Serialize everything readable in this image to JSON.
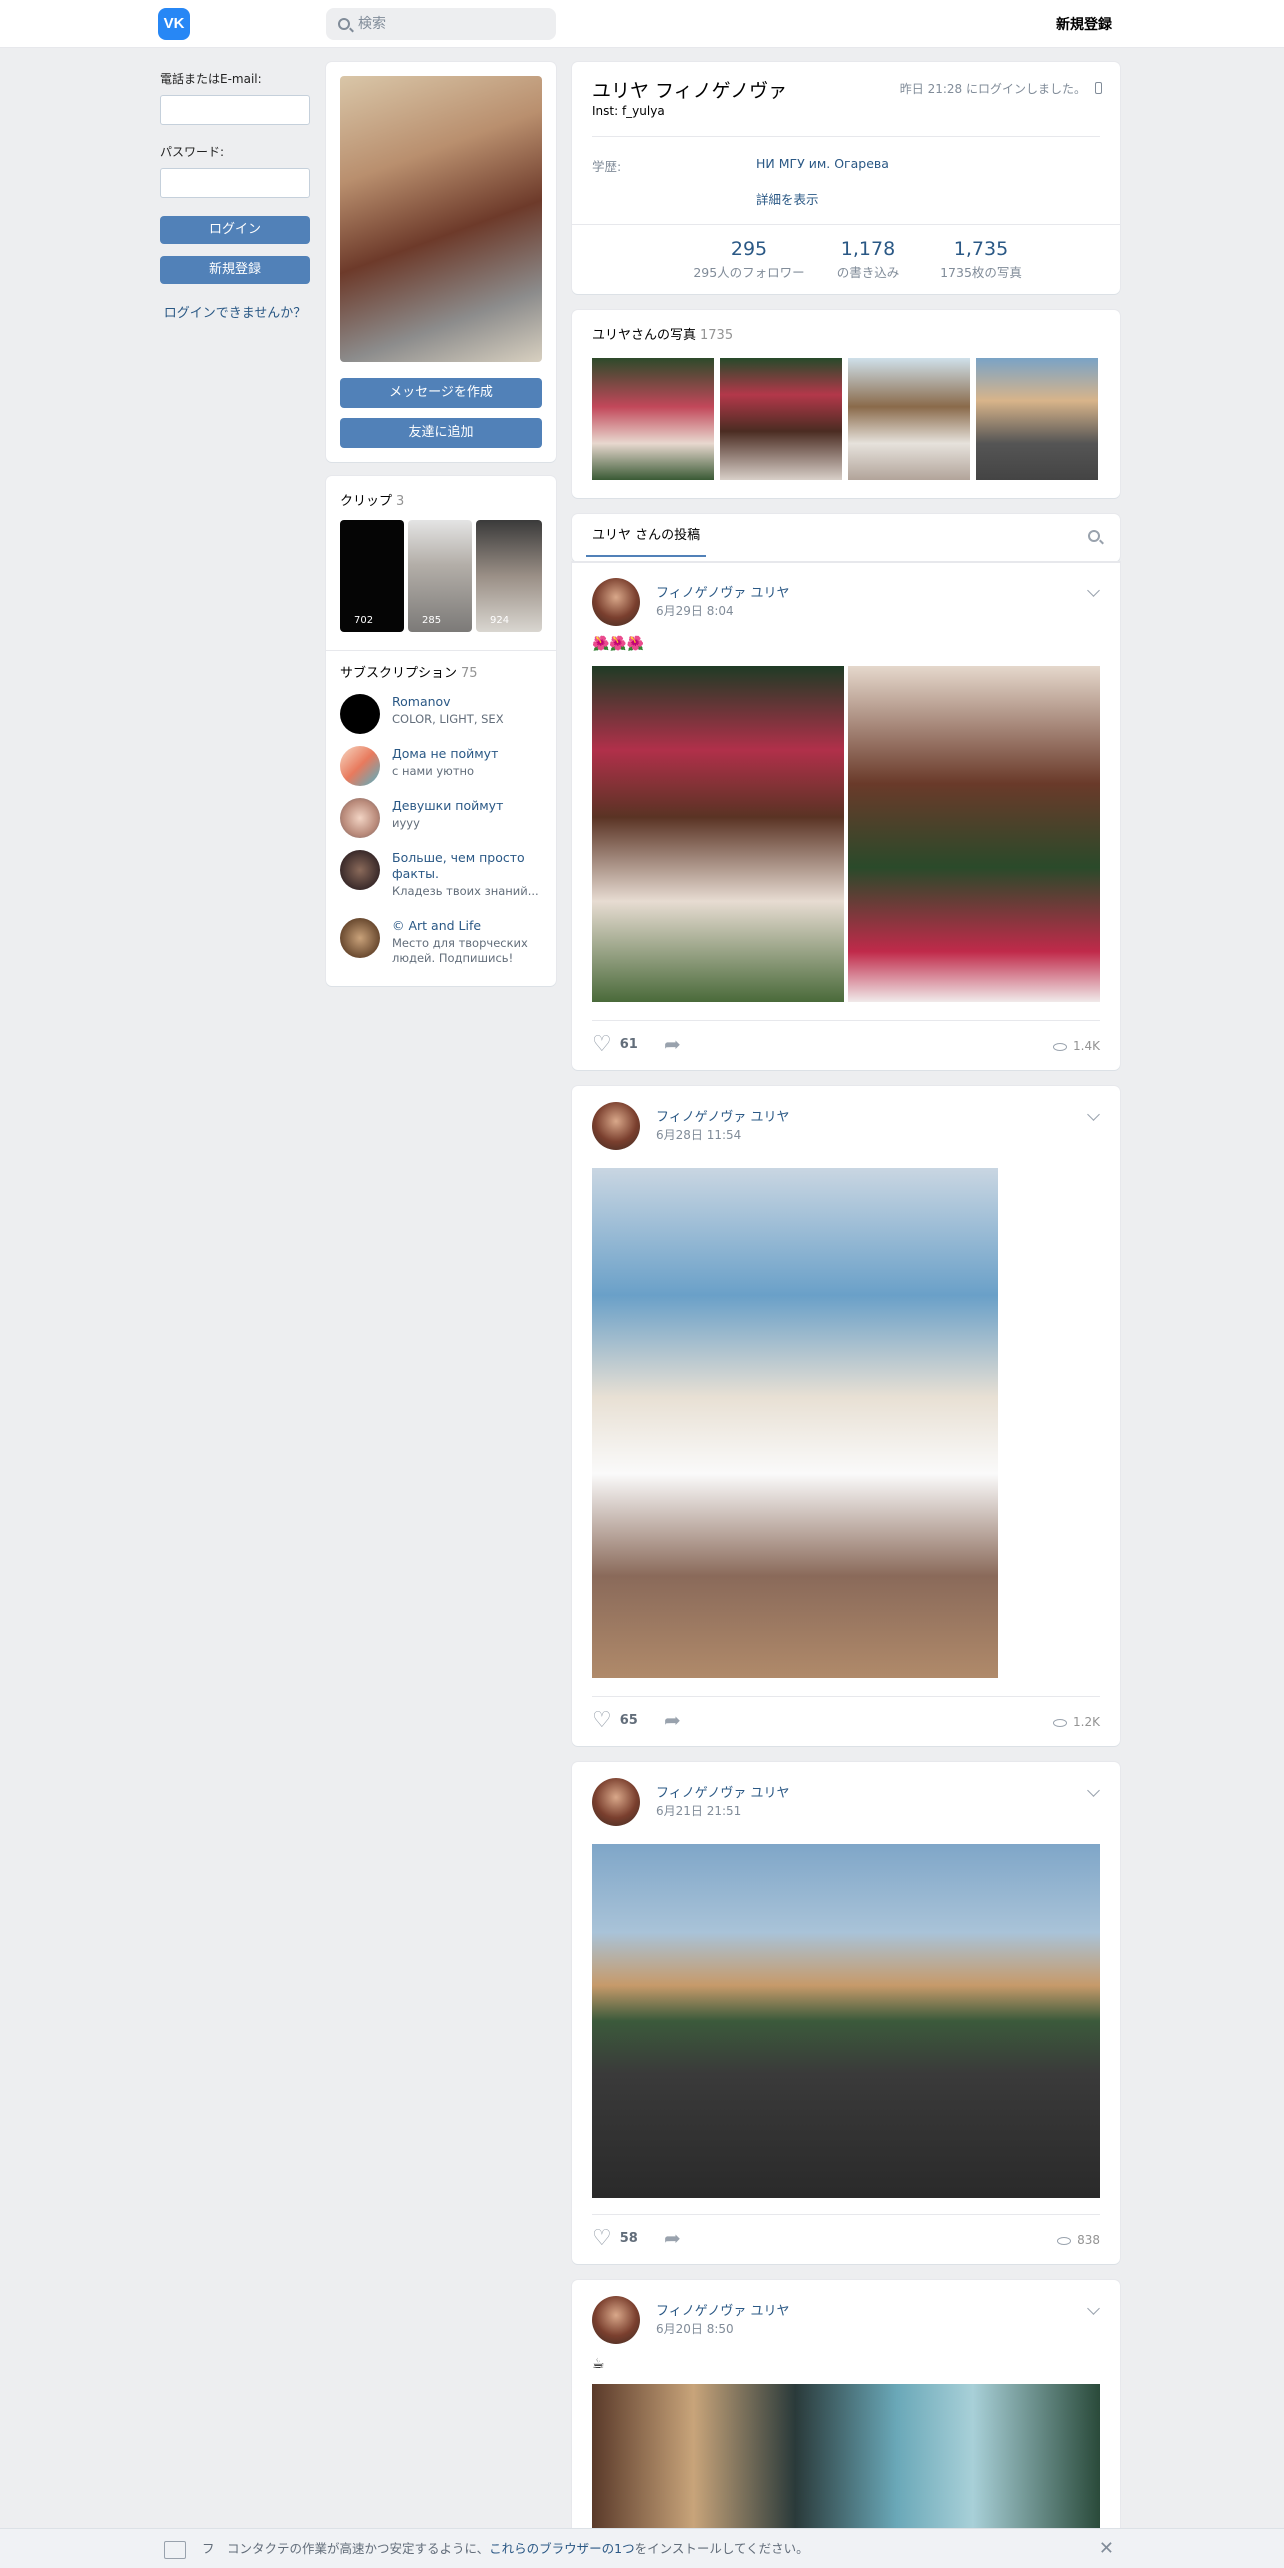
{
  "header": {
    "logo": "VK",
    "search_placeholder": "検索",
    "signup": "新規登録"
  },
  "login": {
    "email_label": "電話またはE-mail:",
    "password_label": "パスワード:",
    "login_button": "ログイン",
    "register_button": "新規登録",
    "forgot": "ログインできませんか？"
  },
  "profile_card": {
    "message_button": "メッセージを作成",
    "add_friend_button": "友達に追加"
  },
  "clips": {
    "title": "クリップ",
    "count": "3",
    "items": [
      {
        "views": "702"
      },
      {
        "views": "285"
      },
      {
        "views": "924"
      }
    ]
  },
  "subscriptions": {
    "title": "サブスクリプション",
    "count": "75",
    "items": [
      {
        "name": "Romanov",
        "desc": "COLOR, LIGHT, SEX"
      },
      {
        "name": "Дома не поймут",
        "desc": "с нами уютно"
      },
      {
        "name": "Девушки поймут",
        "desc": "иууу"
      },
      {
        "name": "Больше, чем просто факты.",
        "desc": "Кладезь твоих знаний..."
      },
      {
        "name": "© Art and Life",
        "desc": "Место для творческих людей. Подпишись!"
      }
    ]
  },
  "profile": {
    "name": "ユリヤ フィノゲノヴァ",
    "status": "Inst: f_yulya",
    "last_seen": "昨日 21:28 にログインしました。",
    "education_label": "学歴:",
    "education_value": "НИ МГУ им. Огарева",
    "show_more": "詳細を表示",
    "stats": [
      {
        "n": "295",
        "l": "295人のフォロワー"
      },
      {
        "n": "1,178",
        "l": "の書き込み"
      },
      {
        "n": "1,735",
        "l": "1735枚の写真"
      }
    ]
  },
  "photos": {
    "title": "ユリヤさんの写真",
    "count": "1735"
  },
  "wall": {
    "tab": "ユリヤ さんの投稿"
  },
  "posts": [
    {
      "author": "フィノゲノヴァ ユリヤ",
      "date": "6月29日 8:04",
      "text": "🌺🌺🌺",
      "likes": "61",
      "views": "1.4K"
    },
    {
      "author": "フィノゲノヴァ ユリヤ",
      "date": "6月28日 11:54",
      "text": "",
      "likes": "65",
      "views": "1.2K"
    },
    {
      "author": "フィノゲノヴァ ユリヤ",
      "date": "6月21日 21:51",
      "text": "",
      "likes": "58",
      "views": "838"
    },
    {
      "author": "フィノゲノヴァ ユリヤ",
      "date": "6月20日 8:50",
      "text": "☕"
    }
  ],
  "banner": {
    "prefix": "フ　コンタクテの作業が高速かつ安定するように、",
    "link": "これらのブラウザーの1つ",
    "suffix": "をインストールしてください。"
  }
}
